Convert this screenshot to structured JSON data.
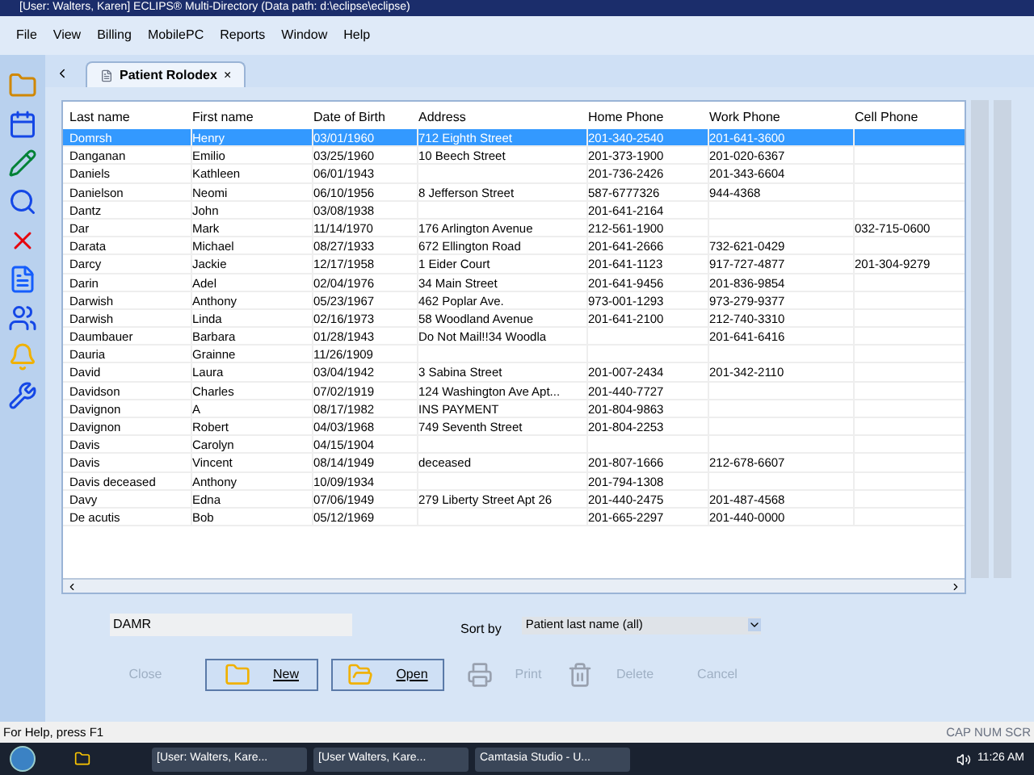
{
  "window": {
    "title": "[User: Walters, Karen]  ECLIPS® Multi-Directory (Data path: d:\\eclipse\\eclipse)"
  },
  "menu": [
    "File",
    "View",
    "Billing",
    "MobilePC",
    "Reports",
    "Window",
    "Help"
  ],
  "tabs": [
    {
      "label": "Patient Rolodex",
      "selected": true,
      "close": "×"
    }
  ],
  "table": {
    "columns": [
      "Last name",
      "First name",
      "Date of Birth",
      "Address",
      "Home Phone",
      "Work Phone",
      "Cell Phone"
    ],
    "rows": [
      {
        "selected": true,
        "last": "Domrsh",
        "first": "Henry",
        "dob": "03/01/1960",
        "address": "712 Eighth Street",
        "home": "201-340-2540",
        "work": "201-641-3600"
      },
      {
        "selected": false,
        "last": "Danganan",
        "first": "Emilio",
        "dob": "03/25/1960",
        "address": "10 Beech Street",
        "home": "201-373-1900",
        "work": "201-020-6367"
      },
      {
        "selected": false,
        "last": "Daniels",
        "first": "Kathleen",
        "dob": "06/01/1943",
        "home": "201-736-2426",
        "work": "201-343-6604"
      },
      {
        "selected": false,
        "last": "Danielson",
        "first": "Neomi",
        "dob": "06/10/1956",
        "address": "8 Jefferson Street",
        "home": "587-6777326",
        "work": "944-4368"
      },
      {
        "selected": false,
        "last": "Dantz",
        "first": "John",
        "dob": "03/08/1938",
        "home": "201-641-2164"
      },
      {
        "selected": false,
        "last": "Dar",
        "first": "Mark",
        "dob": "11/14/1970",
        "address": "176 Arlington Avenue",
        "home": "212-561-1900",
        "cell": "032-715-0600"
      },
      {
        "selected": false,
        "last": "Darata",
        "first": "Michael",
        "dob": "08/27/1933",
        "address": "672 Ellington Road",
        "home": "201-641-2666",
        "work": "732-621-0429"
      },
      {
        "selected": false,
        "last": "Darcy",
        "first": "Jackie",
        "dob": "12/17/1958",
        "address": "1 Eider Court",
        "home": "201-641-1123",
        "work": "917-727-4877",
        "cell": "201-304-9279"
      },
      {
        "selected": false,
        "last": "Darin",
        "first": "Adel",
        "dob": "02/04/1976",
        "address": "34 Main Street",
        "home": "201-641-9456",
        "work": "201-836-9854"
      },
      {
        "selected": false,
        "last": "Darwish",
        "first": "Anthony",
        "dob": "05/23/1967",
        "address": "462 Poplar Ave.",
        "home": "973-001-1293",
        "work": "973-279-9377"
      },
      {
        "selected": false,
        "last": "Darwish",
        "first": "Linda",
        "dob": "02/16/1973",
        "address": "58 Woodland Avenue",
        "home": "201-641-2100",
        "work": "212-740-3310"
      },
      {
        "selected": false,
        "last": "Daumbauer",
        "first": "Barbara",
        "dob": "01/28/1943",
        "address": "Do Not Mail!!34 Woodla",
        "work": "201-641-6416"
      },
      {
        "selected": false,
        "last": "Dauria",
        "first": "Grainne",
        "dob": "11/26/1909"
      },
      {
        "selected": false,
        "last": "David",
        "first": "Laura",
        "dob": "03/04/1942",
        "address": "3 Sabina Street",
        "home": "201-007-2434",
        "work": "201-342-2110"
      },
      {
        "selected": false,
        "last": "Davidson",
        "first": "Charles",
        "dob": "07/02/1919",
        "address": "124 Washington Ave Apt...",
        "home": "201-440-7727"
      },
      {
        "selected": false,
        "last": "Davignon",
        "first": "A",
        "dob": "08/17/1982",
        "address": "INS PAYMENT",
        "home": "201-804-9863"
      },
      {
        "selected": false,
        "last": "Davignon",
        "first": "Robert",
        "dob": "04/03/1968",
        "address": "749 Seventh Street",
        "home": "201-804-2253"
      },
      {
        "selected": false,
        "last": "Davis",
        "first": "Carolyn",
        "dob": "04/15/1904"
      },
      {
        "selected": false,
        "last": "Davis",
        "first": "Vincent",
        "dob": "08/14/1949",
        "address": "deceased",
        "home": "201-807-1666",
        "work": "212-678-6607"
      },
      {
        "selected": false,
        "last": "Davis deceased",
        "first": "Anthony",
        "dob": "10/09/1934",
        "home": "201-794-1308"
      },
      {
        "selected": false,
        "last": "Davy",
        "first": "Edna",
        "dob": "07/06/1949",
        "address": "279 Liberty Street Apt 26",
        "home": "201-440-2475",
        "work": "201-487-4568"
      },
      {
        "selected": false,
        "last": "De acutis",
        "first": "Bob",
        "dob": "05/12/1969",
        "home": "201-665-2297",
        "work": "201-440-0000"
      }
    ]
  },
  "search": {
    "value": "DAMR"
  },
  "sort": {
    "label": "Sort by",
    "value": "Patient last name (all)"
  },
  "buttons": [
    {
      "label": "Close",
      "disabled": true
    },
    {
      "label": "New",
      "disabled": false,
      "kind": "new"
    },
    {
      "label": "Open",
      "disabled": false,
      "kind": "open"
    },
    {
      "label": "Print",
      "disabled": true,
      "kind": "print"
    },
    {
      "label": "Delete",
      "disabled": true,
      "kind": "delete"
    },
    {
      "label": "Cancel",
      "disabled": true
    }
  ],
  "status_bar": {
    "help": "For Help, press F1",
    "indicators": "CAP NUM SCR"
  },
  "taskbar": {
    "tasks": [
      "[User: Walters, Kare...",
      "[User Walters, Kare...",
      "Camtasia Studio - U..."
    ],
    "clock": "11:26 AM"
  }
}
